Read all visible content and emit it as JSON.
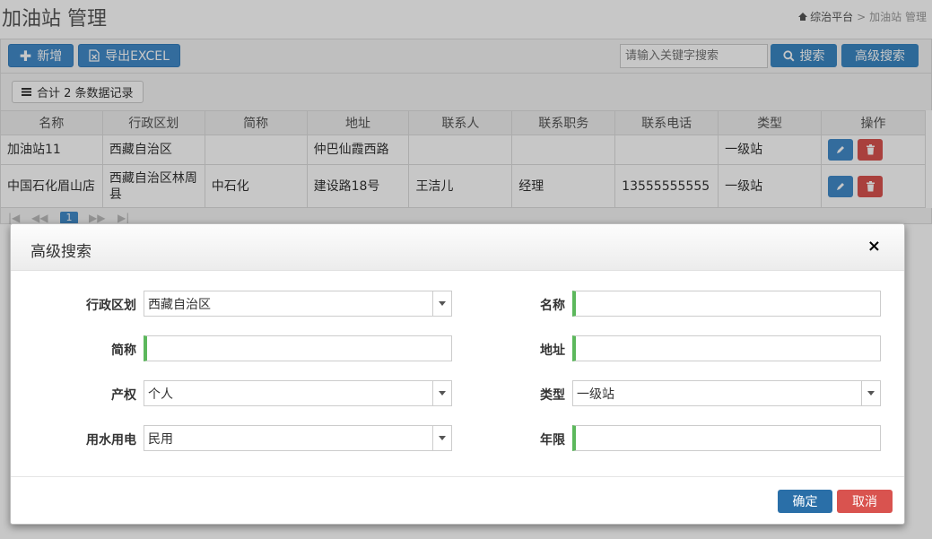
{
  "page": {
    "title": "加油站 管理",
    "breadcrumb": {
      "home": "综治平台",
      "separator": ">",
      "current": "加油站 管理"
    }
  },
  "toolbar": {
    "add_label": "新增",
    "export_label": "导出EXCEL",
    "search_placeholder": "请输入关键字搜索",
    "search_label": "搜索",
    "advanced_label": "高级搜索"
  },
  "summary": {
    "count_label": "合计 2 条数据记录"
  },
  "table": {
    "columns": [
      "名称",
      "行政区划",
      "简称",
      "地址",
      "联系人",
      "联系职务",
      "联系电话",
      "类型",
      "操作"
    ],
    "rows": [
      [
        "加油站11",
        "西藏自治区",
        "",
        "仲巴仙霞西路",
        "",
        "",
        "",
        "一级站"
      ],
      [
        "中国石化眉山店",
        "西藏自治区林周县",
        "中石化",
        "建设路18号",
        "王洁儿",
        "经理",
        "13555555555",
        "一级站"
      ]
    ]
  },
  "pager": {
    "current_page": "1"
  },
  "modal": {
    "title": "高级搜索",
    "close_glyph": "×",
    "fields": {
      "region": {
        "label": "行政区划",
        "value": "西藏自治区"
      },
      "name": {
        "label": "名称",
        "value": ""
      },
      "abbr": {
        "label": "简称",
        "value": ""
      },
      "address": {
        "label": "地址",
        "value": ""
      },
      "ownership": {
        "label": "产权",
        "value": "个人"
      },
      "type": {
        "label": "类型",
        "value": "一级站"
      },
      "water_power": {
        "label": "用水用电",
        "value": "民用"
      },
      "years": {
        "label": "年限",
        "value": ""
      }
    },
    "ok_label": "确定",
    "cancel_label": "取消"
  },
  "colors": {
    "primary": "#428bca",
    "danger": "#d9534f",
    "required": "#5cb85c"
  }
}
